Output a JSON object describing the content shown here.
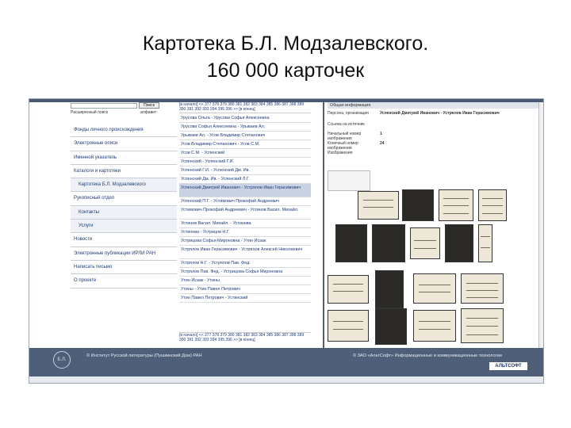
{
  "slide": {
    "title_line1": "Картотека Б.Л. Модзалевского.",
    "title_line2": "160 000 карточек"
  },
  "search": {
    "button_label": "Поиск",
    "advanced_label": "Расширенный поиск",
    "alphabet_label": "алфавит"
  },
  "sidebar": {
    "items": [
      {
        "label": "Фонды личного происхождения"
      },
      {
        "label": "Электронные описи"
      },
      {
        "label": "Именной указатель"
      },
      {
        "label": "Каталоги и картотеки"
      },
      {
        "label": "Картотека Б.Л. Модзалевского"
      },
      {
        "label": "Рукописный отдел"
      },
      {
        "label": "Контакты"
      },
      {
        "label": "Услуги"
      },
      {
        "label": "Новости"
      },
      {
        "label": "Электронные публикации ИРЛИ РАН"
      },
      {
        "label": "Написать письмо"
      },
      {
        "label": "О проекте"
      }
    ]
  },
  "list": {
    "pager_top": "[в начало] << 377 378 379 380 381 382 383 384 385 386 387 388 389 390 391 392 393 394 395 396 >> [в конец]",
    "pager_bottom": "[в начало] << 377 378 379 380 381 382 383 384 385 386 387 388 389 390 391 392 393 394 395 396 >> [в конец]",
    "items": [
      {
        "text": "Урусова Ольга - Урусова Софья Алексеевна"
      },
      {
        "text": "Урусова Софья Алексеевна - Урываев Ал."
      },
      {
        "text": "Урываев Ал. - Усов Владимир Степанович"
      },
      {
        "text": "Усов Владимир Степанович - Усов С.М."
      },
      {
        "text": "Усов С.М. - Успенский"
      },
      {
        "text": "Успенский - Успенский Г.И."
      },
      {
        "text": "Успенский Г.И. - Успенский Дм. Ив."
      },
      {
        "text": "Успенский Дм. Ив. - Успенский Л.Г."
      },
      {
        "text": "Успенский Дмитрий Иванович - Устрялов Иван Герасимович"
      },
      {
        "text": "Успенский П.Г. - Устимович Прокофий Андреевич"
      },
      {
        "text": "Устимович Прокофий Андреевич - Устинов Васил. Михайл."
      },
      {
        "text": "Устинов Васил. Михайл. - Устинова"
      },
      {
        "text": "Устинова - Устрицов Н.Г."
      },
      {
        "text": "Устрицова Софья Мироновна - Утин Исаак"
      },
      {
        "text": "Устрялов Иван Герасимович - Устрялов Алексей Николаевич"
      },
      {
        "text": "Устрялов Н.Г. - Устрялов Пав. Фед."
      },
      {
        "text": "Устрялов Пав. Фед. - Устрицова Софья Мироновна"
      },
      {
        "text": "Утин Исаак - Утины"
      },
      {
        "text": "Утины - Утин Павел Петрович"
      },
      {
        "text": "Утин Павел Петрович - Устинский"
      }
    ]
  },
  "detail": {
    "header": "Общая информация",
    "fields": [
      {
        "key": "Персона, организация",
        "value": "Успенский Дмитрий Иванович - Устрялов Иван Герасимович"
      },
      {
        "key": "Ссылка на источник",
        "value": ""
      },
      {
        "key": "Начальный номер изображения",
        "value": "1"
      },
      {
        "key": "Конечный номер изображения",
        "value": "24"
      },
      {
        "key": "Изображения",
        "value": ""
      }
    ]
  },
  "footer": {
    "left_text": "© Институт Русской литературы (Пушкинский Дом) РАН",
    "right_text": "© ЗАО «АльтСофт» Информационные и коммуникационные технологии",
    "logo_text": "АЛЬТСОФТ",
    "seal_text": "Б.Л."
  },
  "colors": {
    "footer": "#4f5f79",
    "link": "#1e3c78",
    "selected": "#c8d2e2"
  }
}
